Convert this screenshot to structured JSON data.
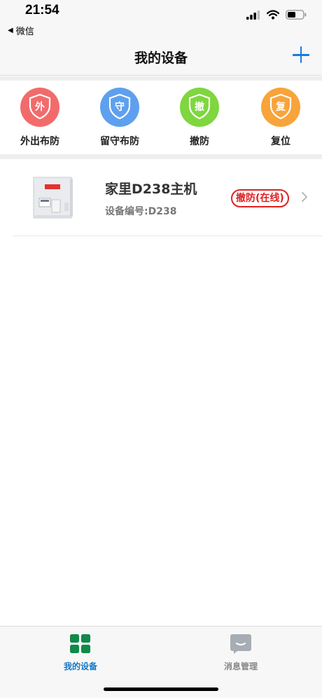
{
  "status_bar": {
    "time": "21:54",
    "back_app": "微信",
    "back_glyph": "◀",
    "icons": [
      "signal-icon",
      "wifi-icon",
      "battery-icon"
    ]
  },
  "nav": {
    "title": "我的设备",
    "add_icon": "plus-icon"
  },
  "actions": [
    {
      "badge": "外",
      "label": "外出布防",
      "color": "#f26b6b"
    },
    {
      "badge": "守",
      "label": "留守布防",
      "color": "#5fa0ee"
    },
    {
      "badge": "撤",
      "label": "撤防",
      "color": "#7fd63f"
    },
    {
      "badge": "复",
      "label": "复位",
      "color": "#f8a43a"
    }
  ],
  "devices": [
    {
      "name": "家里D238主机",
      "serial": "设备编号:D238",
      "status": "撤防(在线)",
      "status_color": "#e02020"
    }
  ],
  "tabs": [
    {
      "label": "我的设备",
      "icon": "grid-icon",
      "active": true,
      "color": "#1478c8"
    },
    {
      "label": "消息管理",
      "icon": "message-icon",
      "active": false,
      "color": "#888888"
    }
  ]
}
